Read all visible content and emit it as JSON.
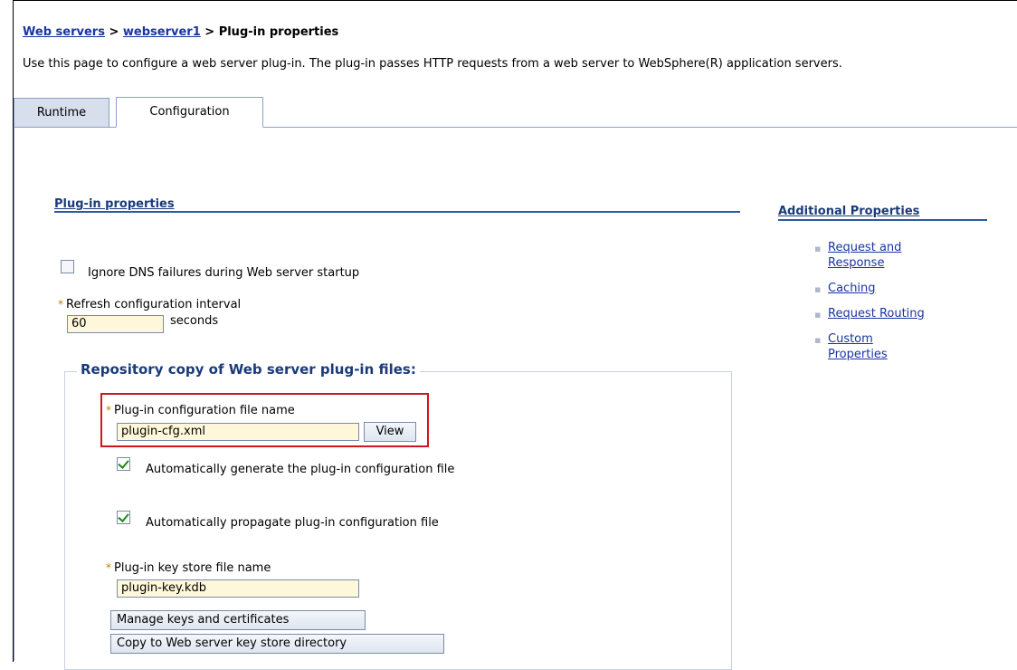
{
  "breadcrumb": {
    "link1": "Web servers",
    "sep1": " > ",
    "link2": "webserver1",
    "sep2": " > ",
    "current": "Plug-in properties"
  },
  "description": "Use this page to configure a web server plug-in. The plug-in passes HTTP requests from a web server to WebSphere(R) application servers.",
  "tabs": {
    "runtime": "Runtime",
    "configuration": "Configuration"
  },
  "plugin_properties": {
    "title": "Plug-in properties",
    "ignore_dns_label": "Ignore DNS failures during Web server startup",
    "ignore_dns_checked": false,
    "refresh_label": "Refresh configuration interval",
    "refresh_value": "60",
    "refresh_unit": "seconds"
  },
  "repository": {
    "legend": "Repository copy of Web server plug-in files:",
    "config_file_label": "Plug-in configuration file name",
    "config_file_value": "plugin-cfg.xml",
    "view_button": "View",
    "auto_generate_label": "Automatically generate the plug-in configuration file",
    "auto_generate_checked": true,
    "auto_propagate_label": "Automatically propagate plug-in configuration file",
    "auto_propagate_checked": true,
    "keystore_label": "Plug-in key store file name",
    "keystore_value": "plugin-key.kdb",
    "manage_keys_button": "Manage keys and certificates",
    "copy_button": "Copy to Web server key store directory"
  },
  "additional_properties": {
    "title": "Additional Properties",
    "items": [
      {
        "label_line1": "Request and",
        "label_line2": "Response"
      },
      {
        "label_line1": "Caching",
        "label_line2": ""
      },
      {
        "label_line1": "Request Routing",
        "label_line2": ""
      },
      {
        "label_line1": "Custom",
        "label_line2": "Properties"
      }
    ]
  },
  "required_marker": "*",
  "colors": {
    "link": "#1a35a0",
    "section_title": "#1a3b7a",
    "input_bg": "#fff7d9",
    "highlight_border": "#d0151e",
    "tab_inactive_bg": "#d6dfeb"
  }
}
